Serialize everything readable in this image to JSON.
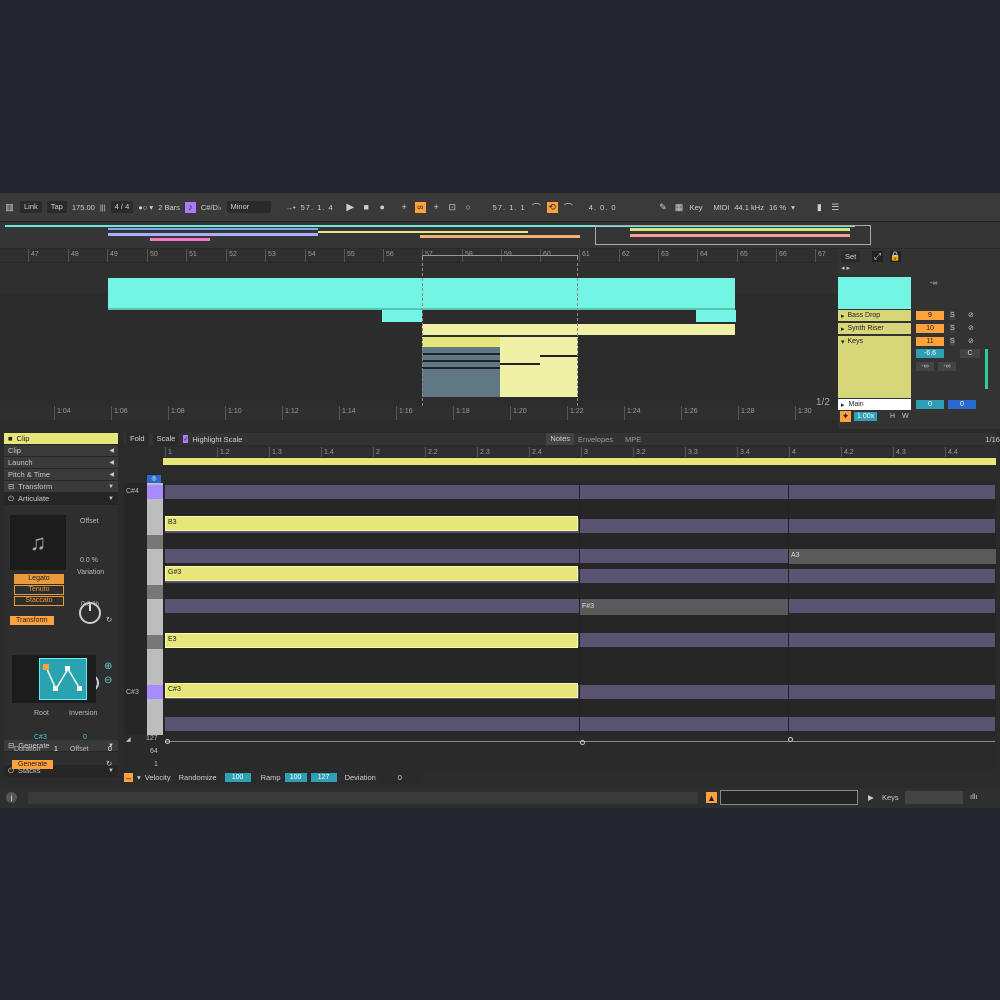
{
  "toolbar": {
    "link": "Link",
    "tap": "Tap",
    "tempo": "175.00",
    "meter": "4 / 4",
    "quant": "2 Bars",
    "key": "C#/D♭",
    "scale": "Minor",
    "position": "57.  1.  4",
    "loop_start": "57.  1.  1",
    "loop_len": "4.  0.  0",
    "key_btn": "Key",
    "midi_btn": "MIDI",
    "sample_rate": "44.1 kHz",
    "cpu": "16 %"
  },
  "bar_ruler": [
    "47",
    "48",
    "49",
    "50",
    "51",
    "52",
    "53",
    "54",
    "55",
    "56",
    "57",
    "58",
    "59",
    "60",
    "61",
    "62",
    "63",
    "64",
    "65",
    "66",
    "67"
  ],
  "time_ruler": [
    "1:04",
    "1:06",
    "1:08",
    "1:10",
    "1:12",
    "1:14",
    "1:16",
    "1:18",
    "1:20",
    "1:22",
    "1:24",
    "1:26",
    "1:28",
    "1:30"
  ],
  "page_indicator": "1/2",
  "mixer": {
    "set": "Set",
    "tracks": [
      {
        "name": "Bass Drop",
        "num": "9",
        "s": "S"
      },
      {
        "name": "Synth Riser",
        "num": "10",
        "s": "S"
      },
      {
        "name": "Keys",
        "num": "11",
        "s": "S"
      }
    ],
    "vol_keys": "-6.6",
    "c": "C",
    "inf": "-∞",
    "main": "Main",
    "main_val": "0",
    "speed": "1.00x",
    "h": "H",
    "w": "W"
  },
  "sidebar": {
    "clip_header": "Clip",
    "items": [
      "Clip",
      "Launch",
      "Pitch & Time",
      "Transform"
    ],
    "articulate": "Articulate",
    "offset_label": "Offset",
    "offset_val": "0.0 %",
    "variation_label": "Variation",
    "variation_val": "0.0 %",
    "legato": "Legato",
    "tenuto": "Tenuto",
    "staccato": "Staccato",
    "transform_btn": "Transform",
    "generate_header": "Generate",
    "stacks": "Stacks",
    "root_label": "Root",
    "inversion_label": "Inversion",
    "root_val": "C#3",
    "inversion_val": "0",
    "duration_label": "Duration",
    "duration_val": "1",
    "offset2_label": "Offset",
    "offset2_val": "0",
    "generate_btn": "Generate"
  },
  "editor": {
    "fold": "Fold",
    "scale": "Scale",
    "highlight": "Highlight Scale",
    "tabs": [
      "Notes",
      "Envelopes",
      "MPE"
    ],
    "grid": "1/16",
    "beat_ruler": [
      "1",
      "1.2",
      "1.3",
      "1.4",
      "2",
      "2.2",
      "2.3",
      "2.4",
      "3",
      "3.2",
      "3.3",
      "3.4",
      "4",
      "4.2",
      "4.3",
      "4.4"
    ],
    "c4": "C#4",
    "c3": "C#3",
    "notes": [
      "B3",
      "G#3",
      "E3",
      "C#3"
    ],
    "ghosts": [
      "A3",
      "F#3"
    ],
    "vel_scale": [
      "127",
      "64",
      "1"
    ]
  },
  "velocity": {
    "label": "Velocity",
    "randomize": "Randomize",
    "rand_val": "100",
    "ramp": "Ramp",
    "ramp_a": "100",
    "ramp_b": "127",
    "deviation": "Deviation",
    "dev_val": "0"
  },
  "status": {
    "track": "Keys"
  }
}
